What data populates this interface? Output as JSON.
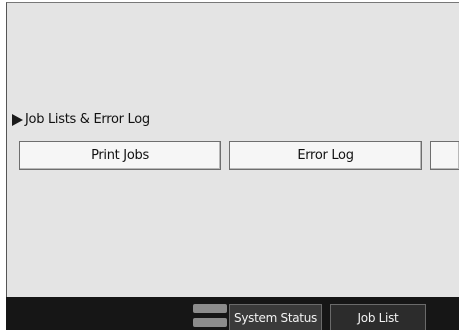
{
  "section": {
    "label": "Job Lists & Error Log"
  },
  "buttons": {
    "print_jobs": "Print Jobs",
    "error_log": "Error Log"
  },
  "taskbar": {
    "system_status": "System Status",
    "job_list": "Job List"
  }
}
